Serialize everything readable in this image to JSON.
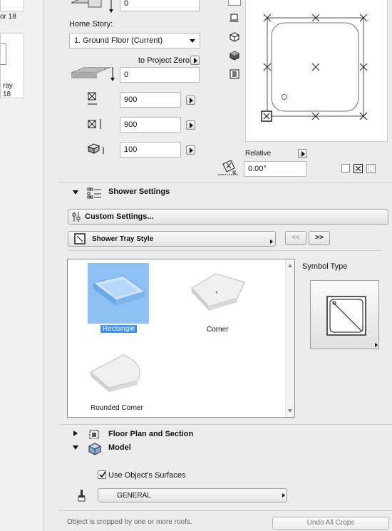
{
  "left_strip": {
    "item1_label": "or 18",
    "item2_label_a": "ray",
    "item2_label_b": "18"
  },
  "geometry": {
    "top_value": "0",
    "home_story_label": "Home Story:",
    "home_story_value": "1. Ground Floor (Current)",
    "to_project_zero_label": "to Project Zero",
    "elevation_value": "0",
    "width_value": "900",
    "length_value": "900",
    "height_value": "100",
    "relative_label": "Relative",
    "angle_value": "0.00°"
  },
  "shower_settings": {
    "title": "Shower Settings",
    "custom_settings_label": "Custom Settings...",
    "style_label": "Shower Tray Style",
    "prev_label": "<<",
    "next_label": ">>",
    "symbol_type_label": "Symbol Type",
    "gallery": [
      {
        "label": "Rectangle",
        "selected": true
      },
      {
        "label": "Corner",
        "selected": false
      },
      {
        "label": "Rounded Corner",
        "selected": false
      }
    ]
  },
  "floor_plan": {
    "title": "Floor Plan and Section"
  },
  "model": {
    "title": "Model",
    "use_surfaces_label": "Use Object's Surfaces",
    "use_surfaces_checked": true,
    "surface_value": "GENERAL"
  },
  "footer": {
    "status_text": "Object is cropped by one or more roofs.",
    "undo_crops_label": "Undo All Crops"
  },
  "colors": {
    "selection": "#3b8ff0",
    "selected_thumb": "#8ec0f6"
  }
}
